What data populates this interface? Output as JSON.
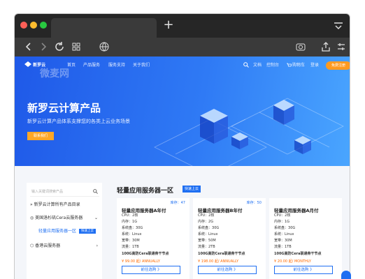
{
  "browser": {
    "new_tab": "+"
  },
  "nav": {
    "logo": "新罗云",
    "watermark": "微麦网",
    "items": [
      "首页",
      "产品服务",
      "服务支持",
      "关于我们"
    ],
    "right": [
      "文档",
      "控制台",
      "购物车",
      "登录"
    ],
    "login_button": "免费注册"
  },
  "hero": {
    "title": "新罗云计算产品",
    "subtitle": "新罗云计算产品体系支撑您的各类上云业务场景",
    "cta": "联系我们"
  },
  "sidebar": {
    "search_placeholder": "输入关键词搜索产品",
    "items": [
      {
        "label": "新罗云计算所有产品目录"
      },
      {
        "label": "美国洛杉矶Cera云服务器"
      },
      {
        "label": "轻量应用服务器一区",
        "badge": "快速上云"
      },
      {
        "label": "香港云服务器"
      }
    ]
  },
  "section": {
    "title": "轻量应用服务器一区",
    "badge": "快速上云"
  },
  "cards": [
    {
      "stock": "库存：47",
      "name": "轻量应用服务器A年付",
      "cpu": "CPU：",
      "cpu_v": "2核",
      "mem": "内存：",
      "mem_v": "1G",
      "disk": "系统盘：",
      "disk_v": "30G",
      "os": "系统：",
      "os_v": "Linux",
      "bw": "宽带：",
      "bw_v": "30M",
      "traffic": "流量：",
      "traffic_v": "1TB",
      "line": "100G高防Cera联通骨干节点",
      "price": "¥ 99.00 起/ ANNUALLY",
      "buy": "前往选购 》"
    },
    {
      "stock": "库存：50",
      "name": "轻量应用服务器B年付",
      "cpu": "CPU：",
      "cpu_v": "2核",
      "mem": "内存：",
      "mem_v": "2G",
      "disk": "系统盘：",
      "disk_v": "30G",
      "os": "系统：",
      "os_v": "Linux",
      "bw": "宽带：",
      "bw_v": "50M",
      "traffic": "流量：",
      "traffic_v": "2TB",
      "line": "100G高防Cera联通骨干节点",
      "price": "¥ 198.00 起/ ANNUALLY",
      "buy": "前往选购 》"
    },
    {
      "stock": "",
      "name": "轻量应用服务器A月付",
      "cpu": "CPU：",
      "cpu_v": "2核",
      "mem": "内存：",
      "mem_v": "1G",
      "disk": "系统盘：",
      "disk_v": "30G",
      "os": "系统：",
      "os_v": "Linux",
      "bw": "宽带：",
      "bw_v": "30M",
      "traffic": "流量：",
      "traffic_v": "1TB",
      "line": "100G高防Cera联通骨干节点",
      "price": "¥ 20.00 起/ MONTHLY",
      "buy": "前往选购 》"
    }
  ],
  "colors": {
    "brand": "#1f6ff2",
    "accent": "#ff9a1f",
    "price": "#ff6a00"
  }
}
